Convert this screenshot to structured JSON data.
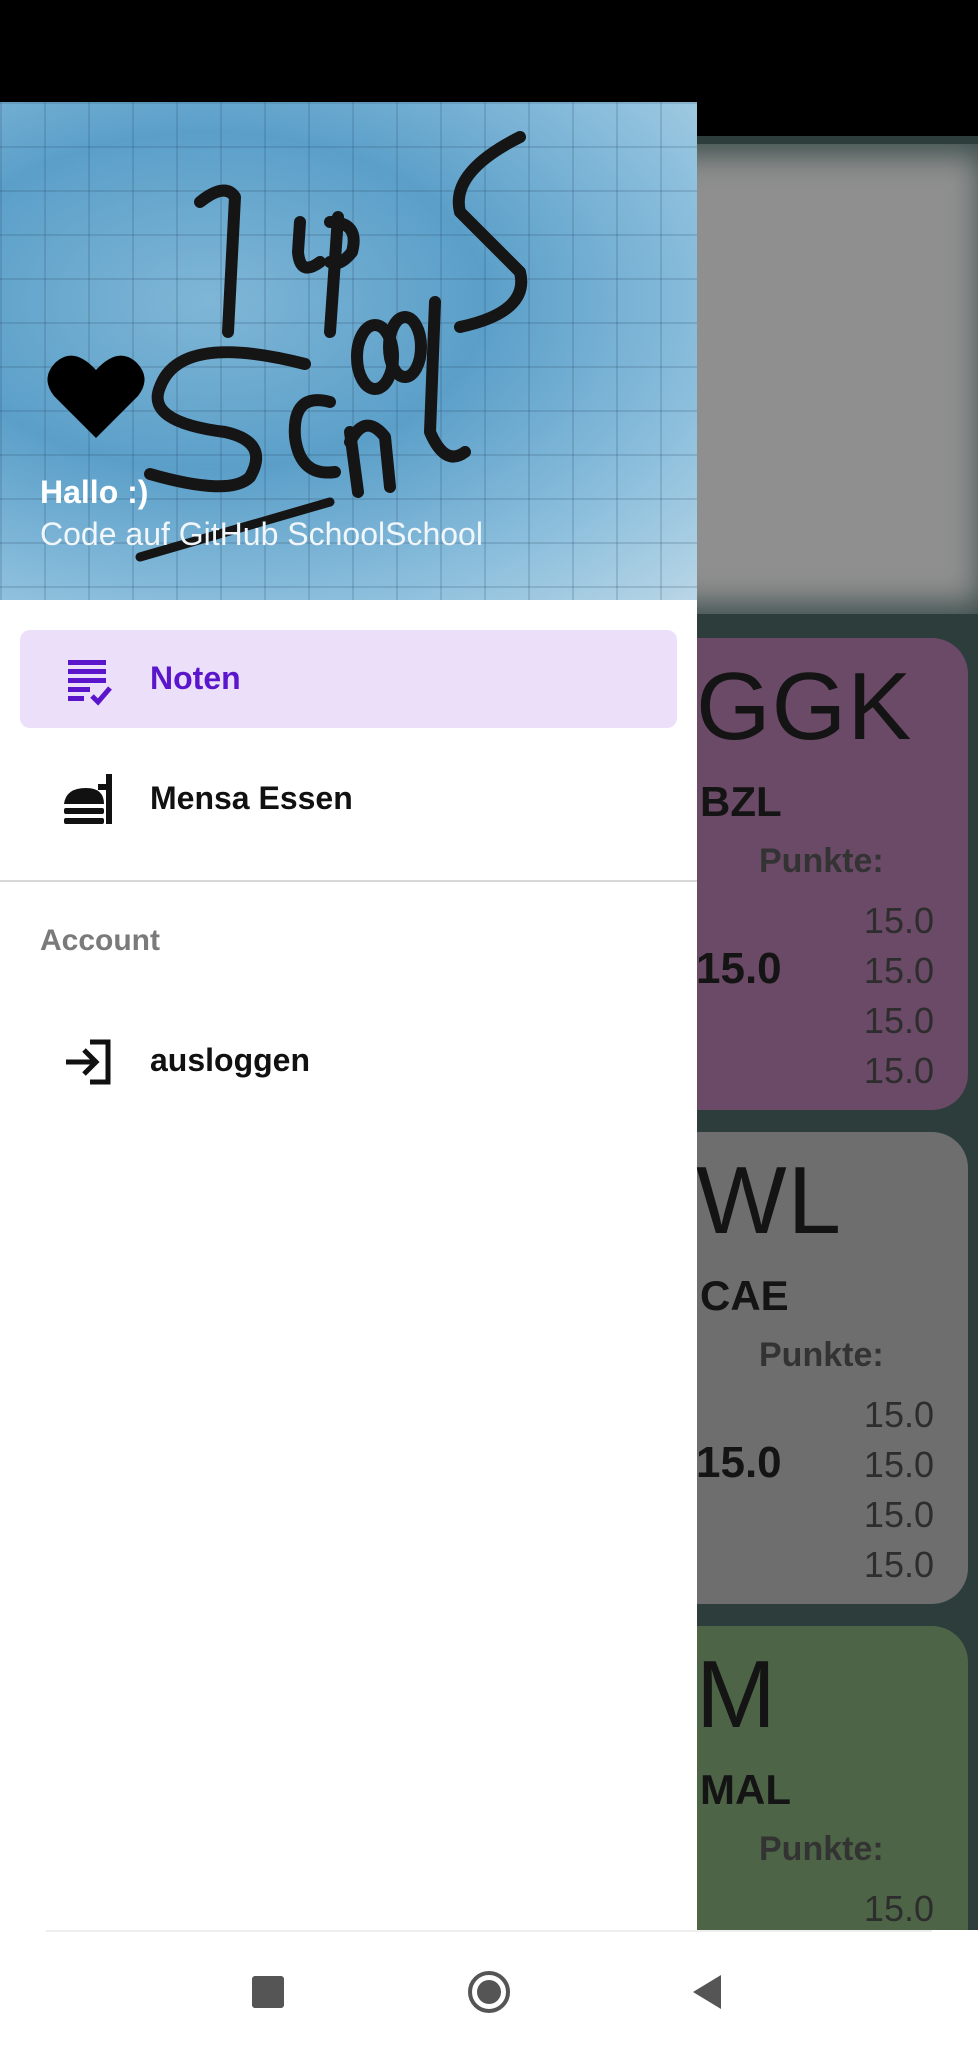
{
  "drawer": {
    "greeting": "Hallo :)",
    "github_link": "Code auf GitHub SchoolSchool",
    "logo_icon": "schoolschool-logo",
    "heart_icon": "heart-icon",
    "items": [
      {
        "label": "Noten",
        "icon": "grades-list-icon",
        "selected": true
      },
      {
        "label": "Mensa Essen",
        "icon": "food-icon",
        "selected": false
      }
    ],
    "account_section": {
      "title": "Account",
      "items": [
        {
          "label": "ausloggen",
          "icon": "login-icon"
        }
      ]
    },
    "accent_color": "#5b16cc",
    "selected_bg": "#ebdffa"
  },
  "background": {
    "cards": [
      {
        "subject": "GGK",
        "teacher": "BZL",
        "punkte_label": "Punkte:",
        "average": "15.0",
        "points": [
          "15.0",
          "15.0",
          "15.0",
          "15.0"
        ],
        "color": "#6a4a66"
      },
      {
        "subject": "WL",
        "teacher": "CAE",
        "punkte_label": "Punkte:",
        "average": "15.0",
        "points": [
          "15.0",
          "15.0",
          "15.0",
          "15.0"
        ],
        "color": "#6e6e6e"
      },
      {
        "subject": "M",
        "teacher": "MAL",
        "punkte_label": "Punkte:",
        "average": "",
        "points": [
          "15.0"
        ],
        "color": "#4d6546"
      }
    ]
  },
  "navbar": {
    "recents_icon": "square-icon",
    "home_icon": "circle-icon",
    "back_icon": "triangle-back-icon"
  }
}
